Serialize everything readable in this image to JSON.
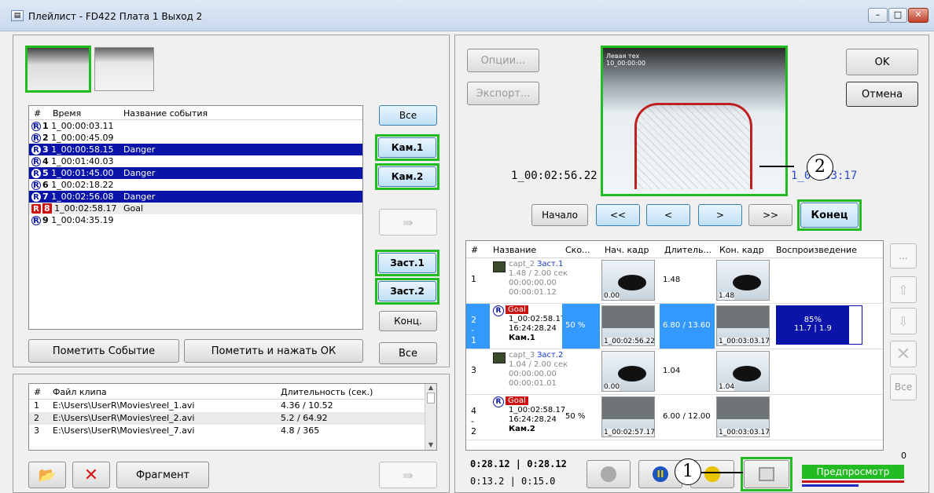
{
  "window": {
    "title": "Плейлист - FD422 Плата 1 Выход 2",
    "icon": "playlist-icon"
  },
  "events": {
    "headers": [
      "#",
      "Время",
      "Название события"
    ],
    "rows": [
      {
        "n": "1",
        "time": "1_00:00:03.11",
        "name": "",
        "state": "normal"
      },
      {
        "n": "2",
        "time": "1_00:00:45.09",
        "name": "",
        "state": "normal"
      },
      {
        "n": "3",
        "time": "1_00:00:58.15",
        "name": "Danger",
        "state": "selected"
      },
      {
        "n": "4",
        "time": "1_00:01:40.03",
        "name": "",
        "state": "normal"
      },
      {
        "n": "5",
        "time": "1_00:01:45.00",
        "name": "Danger",
        "state": "selected"
      },
      {
        "n": "6",
        "time": "1_00:02:18.22",
        "name": "",
        "state": "normal"
      },
      {
        "n": "7",
        "time": "1_00:02:56.08",
        "name": "Danger",
        "state": "selected"
      },
      {
        "n": "8",
        "time": "1_00:02:58.17",
        "name": "Goal",
        "state": "goal"
      },
      {
        "n": "9",
        "time": "1_00:04:35.19",
        "name": "",
        "state": "normal"
      }
    ]
  },
  "left_buttons": {
    "all": "Все",
    "cam1": "Кам.1",
    "cam2": "Кам.2",
    "zast1": "Заст.1",
    "zast2": "Заст.2",
    "konc": "Конц.",
    "mark_event": "Пометить Событие",
    "mark_ok": "Пометить и нажать ОК",
    "all2": "Все",
    "fragment": "Фрагмент"
  },
  "clips": {
    "headers": [
      "#",
      "Файл клипа",
      "Длительность (сек.)"
    ],
    "rows": [
      {
        "n": "1",
        "file": "E:\\Users\\UserR\\Movies\\reel_1.avi",
        "dur": "4.36 / 10.52"
      },
      {
        "n": "2",
        "file": "E:\\Users\\UserR\\Movies\\reel_2.avi",
        "dur": "5.2 / 64.92"
      },
      {
        "n": "3",
        "file": "E:\\Users\\UserR\\Movies\\reel_7.avi",
        "dur": "4.8 / 365"
      }
    ]
  },
  "right_buttons": {
    "options": "Опции...",
    "export": "Экспорт...",
    "ok": "OK",
    "cancel": "Отмена"
  },
  "player": {
    "time_left": "1_00:02:56.22",
    "time_right": "1_00:03:17",
    "video_caption": "Левая тех\n10_00:00:00",
    "callout_video": "2",
    "callout_preview": "1"
  },
  "nav": {
    "start": "Начало",
    "rew": "<<",
    "prev": "<",
    "next": ">",
    "fwd": ">>",
    "end": "Конец"
  },
  "playlist": {
    "headers": [
      "#",
      "Название",
      "Ско...",
      "Нач. кадр",
      "Длитель...",
      "Кон. кадр",
      "Воспроизведение"
    ],
    "rows": [
      {
        "n": "1",
        "line1": "capt_2",
        "tag": "Заст.1",
        "line2": "1.48 / 2.00 сек",
        "line3": "00:00:00.00",
        "line4": "00:00:01.12",
        "speed": "",
        "start_lbl": "0.00",
        "dur": "1.48",
        "end_lbl": "1.48",
        "play": "",
        "kind": "capt"
      },
      {
        "n": "2 - 1",
        "line1": "Goal",
        "tag": "",
        "line2": "1_00:02:58.17",
        "line3": "16:24:28.24",
        "line4": "Кам.1",
        "speed": "50 %",
        "start_lbl": "1_00:02:56.22",
        "dur": "6.80 / 13.60",
        "end_lbl": "1_00:03:03.17",
        "play": "85%\n11.7 | 1.9",
        "kind": "goal",
        "selected": true
      },
      {
        "n": "3",
        "line1": "capt_3",
        "tag": "Заст.2",
        "line2": "1.04 / 2.00 сек",
        "line3": "00:00:00.00",
        "line4": "00:00:01.01",
        "speed": "",
        "start_lbl": "0.00",
        "dur": "1.04",
        "end_lbl": "1.04",
        "play": "",
        "kind": "capt"
      },
      {
        "n": "4 - 2",
        "line1": "Goal",
        "tag": "",
        "line2": "1_00:02:58.17",
        "line3": "16:24:28.24",
        "line4": "Кам.2",
        "speed": "50 %",
        "start_lbl": "1_00:02:57.17",
        "dur": "6.00 / 12.00",
        "end_lbl": "1_00:03:03.17",
        "play": "",
        "kind": "goal"
      }
    ],
    "play_progress": 0.85
  },
  "side": {
    "more": "...",
    "all": "Все",
    "count": "0"
  },
  "bottom": {
    "time1": "0:28.12 | 0:28.12",
    "time2": "0:13.2 | 0:15.0",
    "preview": "Предпросмотр"
  },
  "colors": {
    "selected": "#0a14a8",
    "highlight": "#22bb22",
    "preview": "#22bb22",
    "goal_tag": "#cc1111"
  }
}
